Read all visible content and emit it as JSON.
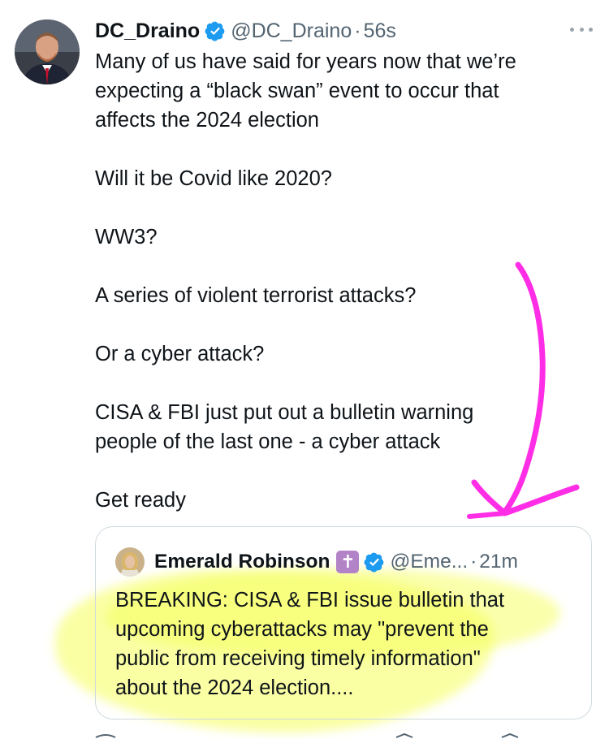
{
  "tweet": {
    "display_name": "DC_Draino",
    "handle": "@DC_Draino",
    "separator": "·",
    "time": "56s",
    "verified_icon": "verified-badge-icon",
    "lines": [
      "Many of us have said for years now that we’re",
      "expecting a “black swan” event to occur that",
      "affects the 2024 election",
      "",
      "Will it be Covid like 2020?",
      "",
      "WW3?",
      "",
      "A series of violent terrorist attacks?",
      "",
      "Or a cyber attack?",
      "",
      "CISA & FBI just put out a bulletin warning",
      "people of the last one - a cyber attack",
      "",
      "Get ready"
    ]
  },
  "quoted": {
    "display_name": "Emerald Robinson",
    "badge": "✝",
    "handle": "@Eme...",
    "separator": "·",
    "time": "21m",
    "lines": [
      "BREAKING: CISA & FBI issue bulletin that",
      "upcoming cyberattacks may \"prevent the",
      "public from receiving timely information\"",
      "about the 2024 election...."
    ]
  },
  "colors": {
    "verified_blue": "#1d9bf0",
    "annotation_magenta": "#ff2ee6",
    "highlight_yellow": "#f5ff5a",
    "muted_text": "#536471"
  }
}
